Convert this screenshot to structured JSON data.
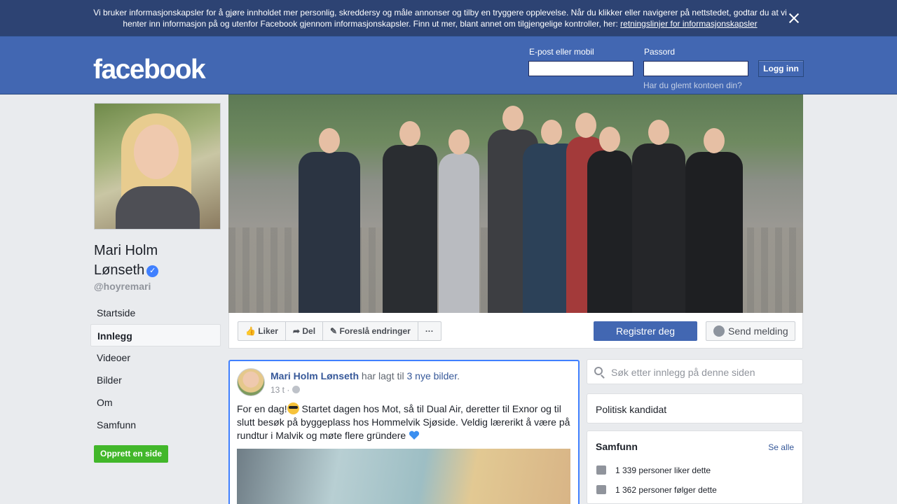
{
  "cookie_banner": {
    "text": "Vi bruker informasjonskapsler for å gjøre innholdet mer personlig, skreddersy og måle annonser og tilby en tryggere opplevelse. Når du klikker eller navigerer på nettstedet, godtar du at vi henter inn informasjon på og utenfor Facebook gjennom informasjonskapsler. Finn ut mer, blant annet om tilgjengelige kontroller, her: ",
    "link": "retningslinjer for informasjonskapsler"
  },
  "header": {
    "logo": "facebook",
    "email_label": "E-post eller mobil",
    "password_label": "Passord",
    "login_button": "Logg inn",
    "forgot_link": "Har du glemt kontoen din?"
  },
  "profile": {
    "name_line1": "Mari Holm",
    "name_line2": "Lønseth",
    "verified_icon": "✓",
    "handle": "@hoyremari"
  },
  "nav": {
    "items": [
      "Startside",
      "Innlegg",
      "Videoer",
      "Bilder",
      "Om",
      "Samfunn"
    ],
    "active": "Innlegg",
    "create_page": "Opprett en side"
  },
  "actions": {
    "like": "Liker",
    "share": "Del",
    "suggest": "Foreslå endringer",
    "more": "···",
    "register": "Registrer deg",
    "message": "Send melding"
  },
  "post": {
    "author": "Mari Holm Lønseth",
    "action_text": " har lagt til ",
    "photos_link": "3 nye bilder",
    "period": ".",
    "time": "13 t · ",
    "text_part1": "For en dag!",
    "text_part2": " Startet dagen hos Mot, så til Dual Air, deretter til Exnor og til slutt besøk på byggeplass hos Hommelvik Sjøside. Veldig lærerikt å være på rundtur i Malvik og møte flere gründere "
  },
  "sidebar": {
    "search_placeholder": "Søk etter innlegg på denne siden",
    "category": "Politisk kandidat",
    "community_title": "Samfunn",
    "see_all": "Se alle",
    "likes": "1 339 personer liker dette",
    "follows": "1 362 personer følger dette"
  },
  "colors": {
    "brand_blue": "#4267b2",
    "banner_blue": "#2d4373",
    "link_blue": "#365899",
    "green": "#42b72a"
  }
}
